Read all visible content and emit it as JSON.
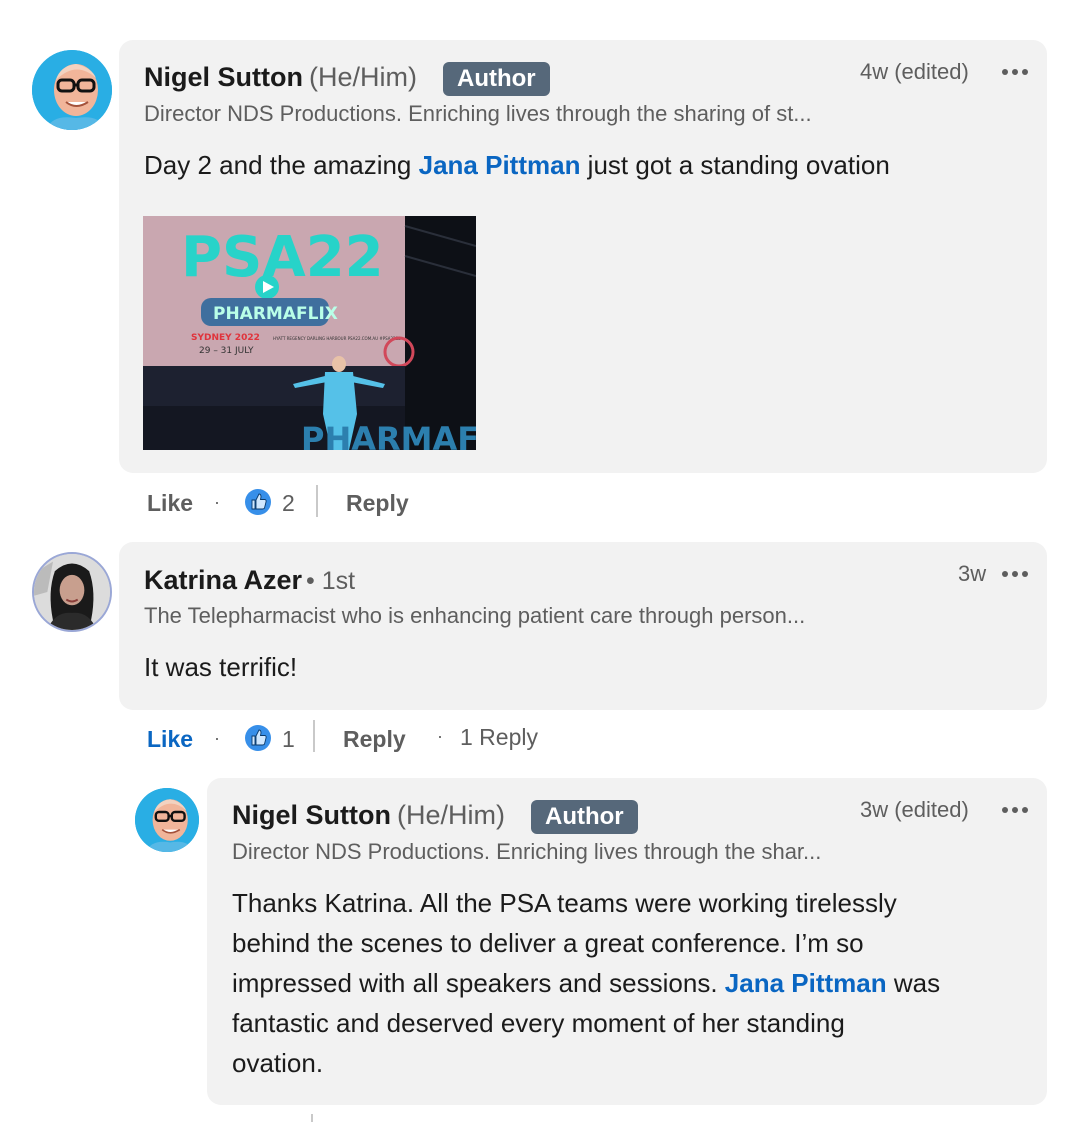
{
  "comments": [
    {
      "author": "Nigel Sutton",
      "pronouns": "(He/Him)",
      "badge": "Author",
      "headline": "Director NDS Productions. Enriching lives through the sharing of st...",
      "time": "4w (edited)",
      "text_pre": "Day 2 and the amazing ",
      "mention": "Jana Pittman",
      "text_post": " just got a standing ovation",
      "image": {
        "screen_title": "PSA22",
        "screen_subtitle": "PHARMAFLIX",
        "screen_city": "SYDNEY 2022",
        "screen_dates": "29 – 31 JULY",
        "screen_venue": "HYATT REGENCY DARLING HARBOUR PSA22.COM.AU #PSA22EB",
        "stage_text": "PHARMAF"
      },
      "actions": {
        "like": "Like",
        "reaction_count": "2",
        "reply": "Reply"
      }
    },
    {
      "author": "Katrina Azer",
      "degree": "• 1st",
      "headline": "The Telepharmacist who is enhancing patient care through person...",
      "time": "3w",
      "text": "It was terrific!",
      "actions": {
        "like": "Like",
        "reaction_count": "1",
        "reply": "Reply",
        "replies": "1 Reply"
      }
    },
    {
      "author": "Nigel Sutton",
      "pronouns": "(He/Him)",
      "badge": "Author",
      "headline": "Director NDS Productions. Enriching lives through the shar...",
      "time": "3w (edited)",
      "line1": "Thanks Katrina. All the PSA teams were working tirelessly",
      "line2": "behind the scenes to deliver a great conference. I’m so",
      "line3_pre": "impressed with all speakers and sessions. ",
      "mention": "Jana Pittman",
      "line3_post": " was",
      "line4": "fantastic and deserved every moment of her standing",
      "line5": "ovation."
    }
  ],
  "colors": {
    "accent": "#0a66c2",
    "bubble": "#f2f2f2",
    "badge": "#56687a"
  },
  "icons": [
    "more-options-icon",
    "like-reaction-icon"
  ]
}
